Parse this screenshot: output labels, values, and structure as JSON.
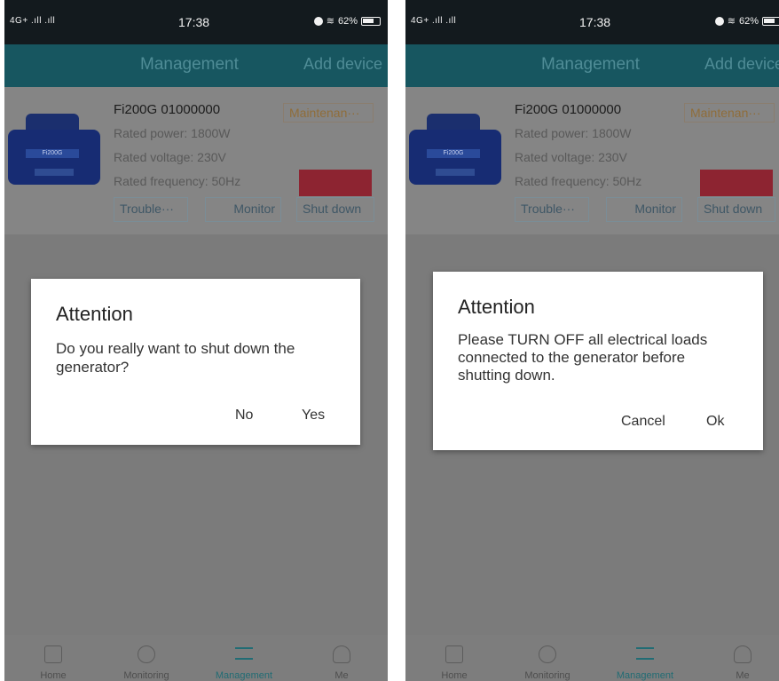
{
  "status": {
    "network": "4G+ .ıll .ıll",
    "time": "17:38",
    "battery": "62%"
  },
  "header": {
    "title": "Management",
    "add_label": "Add device"
  },
  "device": {
    "image_label": "Fi200G",
    "model": "Fi200G 01000000",
    "rated_power": "Rated power:  1800W",
    "rated_voltage": "Rated voltage:  230V",
    "rated_frequency": "Rated frequency:  50Hz",
    "maintenance": "Maintenan···",
    "trouble": "Trouble···",
    "monitor": "Monitor",
    "shutdown": "Shut down"
  },
  "dialog_left": {
    "title": "Attention",
    "message": "Do you really want to shut down the generator?",
    "negative": "No",
    "positive": "Yes"
  },
  "dialog_right": {
    "title": "Attention",
    "message": "Please TURN OFF all electrical loads connected to the generator before shutting down.",
    "negative": "Cancel",
    "positive": "Ok"
  },
  "tabs": [
    "Home",
    "Monitoring",
    "Management",
    "Me"
  ],
  "colors": {
    "header": "#175660",
    "accent": "#216c74",
    "shutdown_button": "#8d2431"
  }
}
